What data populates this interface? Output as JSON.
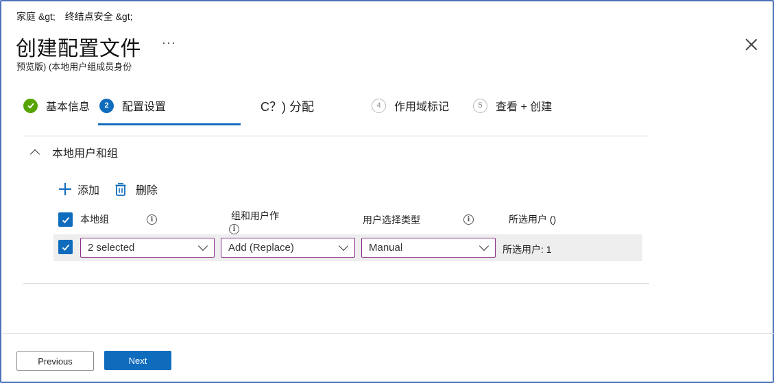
{
  "breadcrumb": [
    "家庭 &gt;",
    "终结点安全 &gt;"
  ],
  "page": {
    "title": "创建配置文件",
    "more": "···",
    "subtitle": "预览版) (本地用户组成员身份"
  },
  "steps": [
    {
      "num": "",
      "label": "基本信息",
      "state": "done"
    },
    {
      "num": "2",
      "label": "配置设置",
      "state": "active"
    },
    {
      "num": "",
      "label": "C？) 分配",
      "state": "plain"
    },
    {
      "num": "4",
      "label": "作用域标记",
      "state": "pending"
    },
    {
      "num": "5",
      "label": "查看 + 创建",
      "state": "pending"
    }
  ],
  "section": {
    "title": "本地用户和组"
  },
  "toolbar": {
    "add_label": "添加",
    "delete_label": "删除"
  },
  "table": {
    "headers": [
      "本地组",
      "组和用户作",
      "用户选择类型",
      "所选用户 ()"
    ],
    "row": {
      "local_group": "2 selected",
      "group_action": "Add (Replace)",
      "selection_type": "Manual",
      "selected_users": "所选用户: 1"
    }
  },
  "footer": {
    "previous_label": "Previous",
    "next_label": "Next"
  },
  "colors": {
    "accent": "#0f6cbd",
    "success": "#57a300",
    "select_border": "#8a2c8a",
    "frame": "#4b72b8"
  }
}
